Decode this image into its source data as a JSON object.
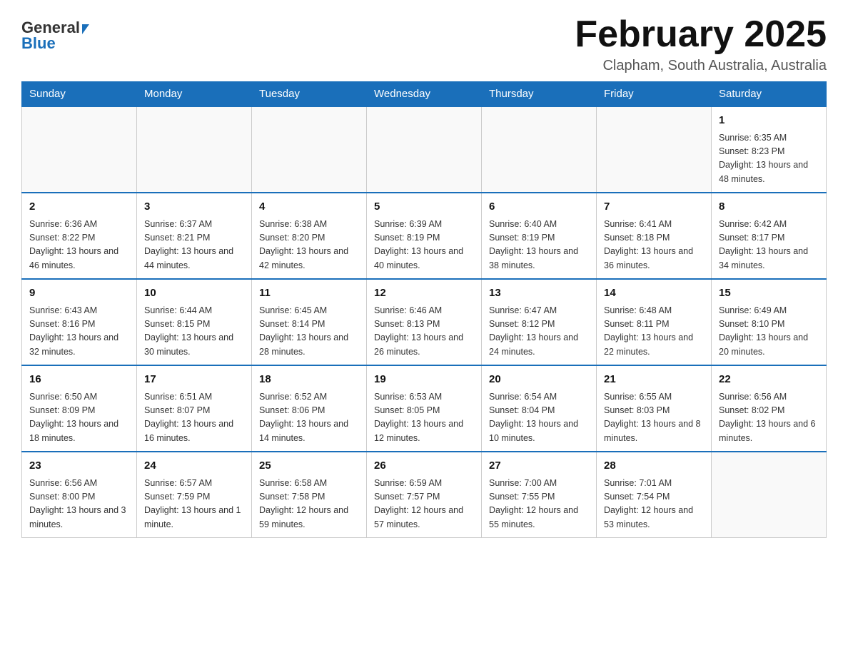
{
  "logo": {
    "general": "General",
    "triangle": "▲",
    "blue": "Blue"
  },
  "header": {
    "title": "February 2025",
    "subtitle": "Clapham, South Australia, Australia"
  },
  "weekdays": [
    "Sunday",
    "Monday",
    "Tuesday",
    "Wednesday",
    "Thursday",
    "Friday",
    "Saturday"
  ],
  "weeks": [
    [
      {
        "day": "",
        "info": ""
      },
      {
        "day": "",
        "info": ""
      },
      {
        "day": "",
        "info": ""
      },
      {
        "day": "",
        "info": ""
      },
      {
        "day": "",
        "info": ""
      },
      {
        "day": "",
        "info": ""
      },
      {
        "day": "1",
        "info": "Sunrise: 6:35 AM\nSunset: 8:23 PM\nDaylight: 13 hours and 48 minutes."
      }
    ],
    [
      {
        "day": "2",
        "info": "Sunrise: 6:36 AM\nSunset: 8:22 PM\nDaylight: 13 hours and 46 minutes."
      },
      {
        "day": "3",
        "info": "Sunrise: 6:37 AM\nSunset: 8:21 PM\nDaylight: 13 hours and 44 minutes."
      },
      {
        "day": "4",
        "info": "Sunrise: 6:38 AM\nSunset: 8:20 PM\nDaylight: 13 hours and 42 minutes."
      },
      {
        "day": "5",
        "info": "Sunrise: 6:39 AM\nSunset: 8:19 PM\nDaylight: 13 hours and 40 minutes."
      },
      {
        "day": "6",
        "info": "Sunrise: 6:40 AM\nSunset: 8:19 PM\nDaylight: 13 hours and 38 minutes."
      },
      {
        "day": "7",
        "info": "Sunrise: 6:41 AM\nSunset: 8:18 PM\nDaylight: 13 hours and 36 minutes."
      },
      {
        "day": "8",
        "info": "Sunrise: 6:42 AM\nSunset: 8:17 PM\nDaylight: 13 hours and 34 minutes."
      }
    ],
    [
      {
        "day": "9",
        "info": "Sunrise: 6:43 AM\nSunset: 8:16 PM\nDaylight: 13 hours and 32 minutes."
      },
      {
        "day": "10",
        "info": "Sunrise: 6:44 AM\nSunset: 8:15 PM\nDaylight: 13 hours and 30 minutes."
      },
      {
        "day": "11",
        "info": "Sunrise: 6:45 AM\nSunset: 8:14 PM\nDaylight: 13 hours and 28 minutes."
      },
      {
        "day": "12",
        "info": "Sunrise: 6:46 AM\nSunset: 8:13 PM\nDaylight: 13 hours and 26 minutes."
      },
      {
        "day": "13",
        "info": "Sunrise: 6:47 AM\nSunset: 8:12 PM\nDaylight: 13 hours and 24 minutes."
      },
      {
        "day": "14",
        "info": "Sunrise: 6:48 AM\nSunset: 8:11 PM\nDaylight: 13 hours and 22 minutes."
      },
      {
        "day": "15",
        "info": "Sunrise: 6:49 AM\nSunset: 8:10 PM\nDaylight: 13 hours and 20 minutes."
      }
    ],
    [
      {
        "day": "16",
        "info": "Sunrise: 6:50 AM\nSunset: 8:09 PM\nDaylight: 13 hours and 18 minutes."
      },
      {
        "day": "17",
        "info": "Sunrise: 6:51 AM\nSunset: 8:07 PM\nDaylight: 13 hours and 16 minutes."
      },
      {
        "day": "18",
        "info": "Sunrise: 6:52 AM\nSunset: 8:06 PM\nDaylight: 13 hours and 14 minutes."
      },
      {
        "day": "19",
        "info": "Sunrise: 6:53 AM\nSunset: 8:05 PM\nDaylight: 13 hours and 12 minutes."
      },
      {
        "day": "20",
        "info": "Sunrise: 6:54 AM\nSunset: 8:04 PM\nDaylight: 13 hours and 10 minutes."
      },
      {
        "day": "21",
        "info": "Sunrise: 6:55 AM\nSunset: 8:03 PM\nDaylight: 13 hours and 8 minutes."
      },
      {
        "day": "22",
        "info": "Sunrise: 6:56 AM\nSunset: 8:02 PM\nDaylight: 13 hours and 6 minutes."
      }
    ],
    [
      {
        "day": "23",
        "info": "Sunrise: 6:56 AM\nSunset: 8:00 PM\nDaylight: 13 hours and 3 minutes."
      },
      {
        "day": "24",
        "info": "Sunrise: 6:57 AM\nSunset: 7:59 PM\nDaylight: 13 hours and 1 minute."
      },
      {
        "day": "25",
        "info": "Sunrise: 6:58 AM\nSunset: 7:58 PM\nDaylight: 12 hours and 59 minutes."
      },
      {
        "day": "26",
        "info": "Sunrise: 6:59 AM\nSunset: 7:57 PM\nDaylight: 12 hours and 57 minutes."
      },
      {
        "day": "27",
        "info": "Sunrise: 7:00 AM\nSunset: 7:55 PM\nDaylight: 12 hours and 55 minutes."
      },
      {
        "day": "28",
        "info": "Sunrise: 7:01 AM\nSunset: 7:54 PM\nDaylight: 12 hours and 53 minutes."
      },
      {
        "day": "",
        "info": ""
      }
    ]
  ]
}
